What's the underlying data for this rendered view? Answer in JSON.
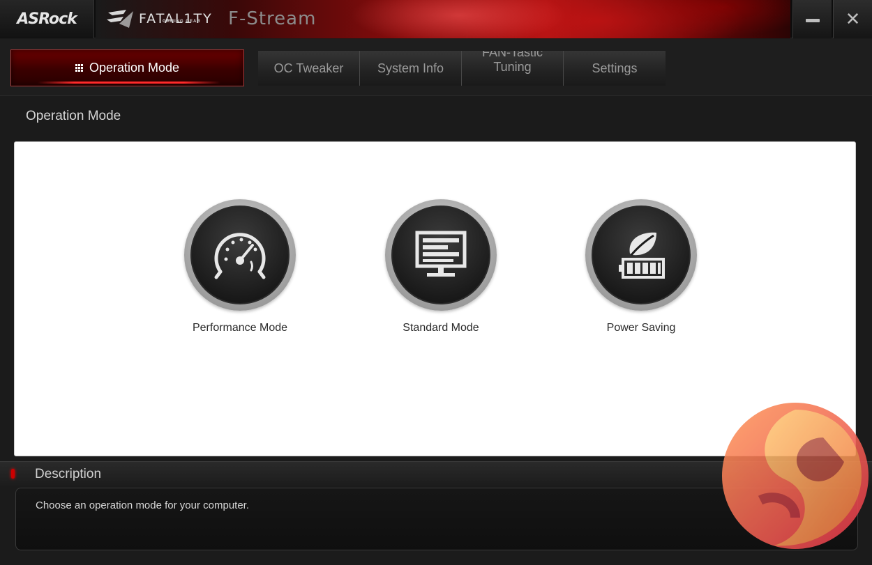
{
  "titlebar": {
    "brand": "ASRock",
    "logo_text": "FATAL1TY",
    "logo_subtext": "GAMING GEAR",
    "app_title": "F-Stream",
    "minimize_icon": "minimize-icon",
    "close_icon": "close-icon"
  },
  "tabs": {
    "active": "Operation Mode",
    "items": [
      {
        "label": "OC Tweaker"
      },
      {
        "label": "System Info"
      },
      {
        "label": "FAN-Tastic Tuning"
      },
      {
        "label": "Settings"
      }
    ]
  },
  "main": {
    "section_title": "Operation Mode",
    "modes": [
      {
        "label": "Performance Mode",
        "icon": "speedometer-icon"
      },
      {
        "label": "Standard Mode",
        "icon": "monitor-icon"
      },
      {
        "label": "Power Saving",
        "icon": "leaf-battery-icon"
      }
    ]
  },
  "description": {
    "title": "Description",
    "text": "Choose an operation mode for your computer."
  },
  "colors": {
    "accent": "#c00000",
    "background": "#1b1b1b",
    "panel": "#ffffff"
  }
}
